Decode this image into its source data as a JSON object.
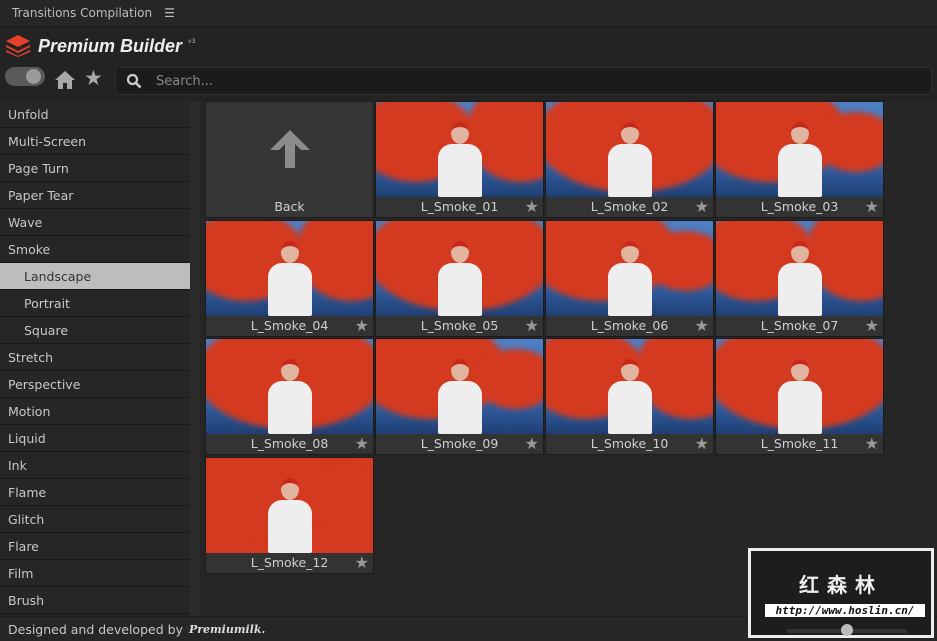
{
  "titlebar": {
    "title": "Transitions Compilation",
    "menu_icon": "hamburger-icon"
  },
  "brand": {
    "name": "Premium Builder",
    "version": "v3"
  },
  "search": {
    "placeholder": "Search..."
  },
  "sidebar": {
    "items": [
      {
        "label": "Unfold"
      },
      {
        "label": "Multi-Screen"
      },
      {
        "label": "Page Turn"
      },
      {
        "label": "Paper Tear"
      },
      {
        "label": "Wave"
      },
      {
        "label": "Smoke"
      },
      {
        "label": "Landscape",
        "sub": true,
        "active": true
      },
      {
        "label": "Portrait",
        "sub": true
      },
      {
        "label": "Square",
        "sub": true
      },
      {
        "label": "Stretch"
      },
      {
        "label": "Perspective"
      },
      {
        "label": "Motion"
      },
      {
        "label": "Liquid"
      },
      {
        "label": "Ink"
      },
      {
        "label": "Flame"
      },
      {
        "label": "Glitch"
      },
      {
        "label": "Flare"
      },
      {
        "label": "Film"
      },
      {
        "label": "Brush"
      }
    ]
  },
  "grid": {
    "back_label": "Back",
    "items": [
      "L_Smoke_01",
      "L_Smoke_02",
      "L_Smoke_03",
      "L_Smoke_04",
      "L_Smoke_05",
      "L_Smoke_06",
      "L_Smoke_07",
      "L_Smoke_08",
      "L_Smoke_09",
      "L_Smoke_10",
      "L_Smoke_11",
      "L_Smoke_12"
    ]
  },
  "footer": {
    "text": "Designed and developed by",
    "logo": "Premiumilk."
  },
  "watermark": {
    "chinese": "红森林",
    "url": "http://www.hoslin.cn/"
  }
}
